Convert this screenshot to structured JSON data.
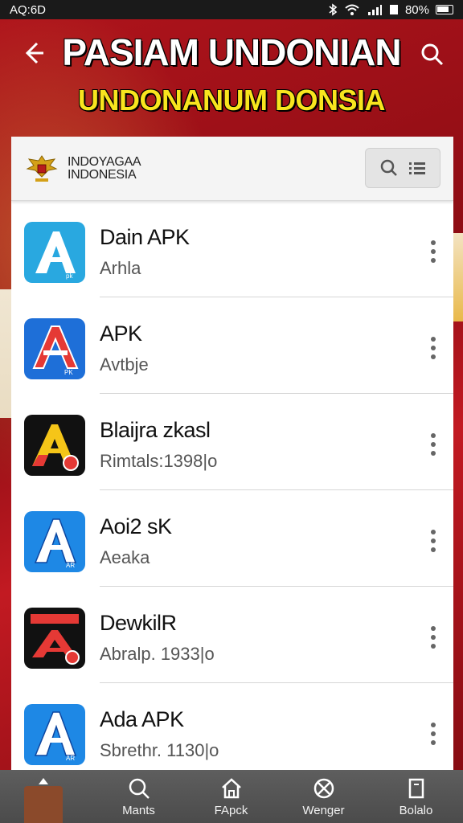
{
  "status_bar": {
    "time": "AQ:6D",
    "battery": "80%"
  },
  "header": {
    "title": "PASIAM UNDONIAN",
    "subtitle": "UNDONANUM DONSIA"
  },
  "brand": {
    "line1": "INDOYAGAA",
    "line2": "INDONESIA"
  },
  "apps": [
    {
      "name": "Dain APK",
      "meta": "Arhla",
      "icon": "blue-a-icon"
    },
    {
      "name": "APK",
      "meta": "Avtbje",
      "icon": "red-a-icon"
    },
    {
      "name": "Blaijra zkasl",
      "meta": "Rimtals:1398|o",
      "icon": "yellow-a-icon"
    },
    {
      "name": "Aoi2 sK",
      "meta": "Aeaka",
      "icon": "blue-a-icon"
    },
    {
      "name": "DewkilR",
      "meta": "Abralp. 1933|o",
      "icon": "red-a-icon"
    },
    {
      "name": "Ada APK",
      "meta": "Sbrethr. 1130|o",
      "icon": "blue-a-icon"
    }
  ],
  "bottom_nav": [
    {
      "label": "",
      "icon": "home-thumb-icon"
    },
    {
      "label": "Mants",
      "icon": "search-icon"
    },
    {
      "label": "FApck",
      "icon": "home-icon"
    },
    {
      "label": "Wenger",
      "icon": "settings-icon"
    },
    {
      "label": "Bolalo",
      "icon": "bookmark-icon"
    }
  ],
  "colors": {
    "accent_red": "#9b1016",
    "title_yellow": "#f8e51e",
    "icon_blue": "#1e88e5",
    "icon_red": "#d32f2f",
    "icon_yellow": "#f5c518"
  }
}
